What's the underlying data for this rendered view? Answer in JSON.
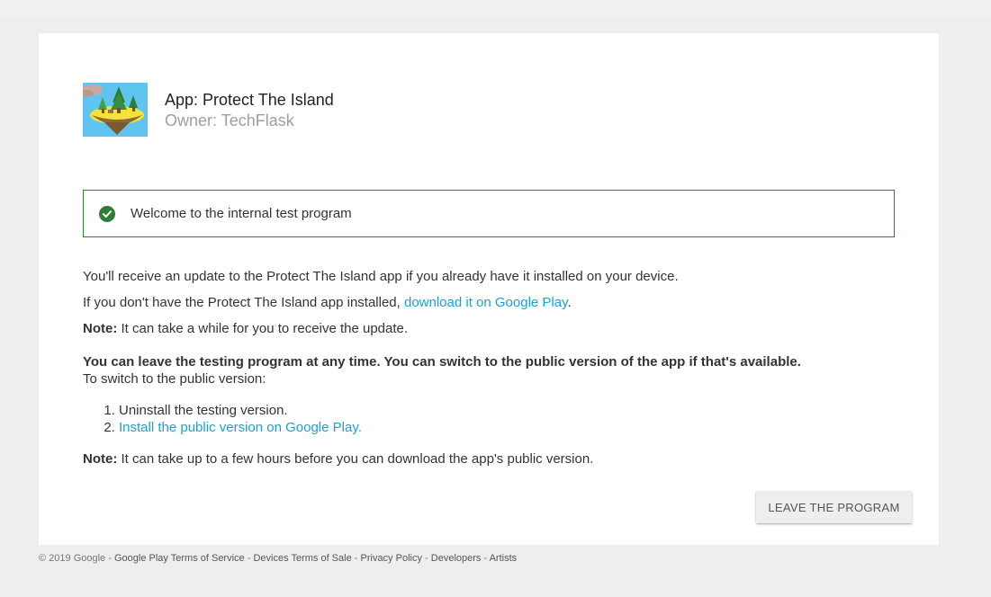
{
  "app": {
    "title": "App: Protect The Island",
    "owner": "Owner: TechFlask",
    "icon": "island-app-icon"
  },
  "banner": {
    "icon": "check-circle-icon",
    "text": "Welcome to the internal test program",
    "color": "#2e7d32"
  },
  "content": {
    "line1": "You'll receive an update to the Protect The Island app if you already have it installed on your device.",
    "line2_prefix": "If you don't have the Protect The Island app installed, ",
    "line2_link": "download it on Google Play",
    "line2_suffix": ".",
    "note_label": "Note:",
    "note1_text": " It can take a while for you to receive the update.",
    "leave_bold": "You can leave the testing program at any time. You can switch to the public version of the app if that's available.",
    "switch_intro": "To switch to the public version:",
    "steps": [
      "Uninstall the testing version.",
      "Install the public version on Google Play."
    ],
    "note2_text": " It can take up to a few hours before you can download the app's public version."
  },
  "buttons": {
    "leave": "LEAVE THE PROGRAM"
  },
  "footer": {
    "copyright": "© 2019 Google",
    "sep": " - ",
    "links": [
      "Google Play Terms of Service",
      "Devices Terms of Sale",
      "Privacy Policy",
      "Developers",
      "Artists"
    ]
  },
  "colors": {
    "link": "#1e9fd4",
    "background": "#eeeeee",
    "card": "#ffffff"
  }
}
